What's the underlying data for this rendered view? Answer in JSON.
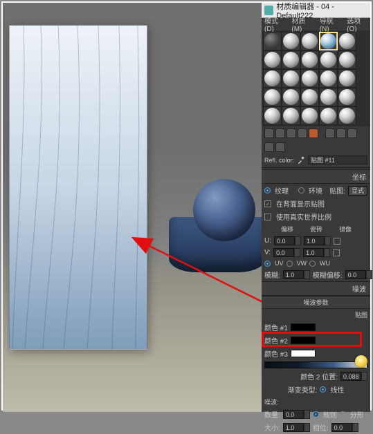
{
  "window": {
    "title": "材质编辑器 - 04 - Default222"
  },
  "menu": {
    "mode": "模式(D)",
    "material": "材质(M)",
    "navigate": "导航(N)",
    "options": "选项(O)"
  },
  "refl": {
    "label": "Refl. color:",
    "swatch": "#c8c8c8",
    "map": "贴图 #11"
  },
  "coord": {
    "header": "坐标",
    "tex": "纹理",
    "env": "环境",
    "maplabel": "贴图:",
    "maptype": "显式",
    "showBehind": "在背面显示贴图",
    "realWorld": "使用真实世界比例",
    "offset": "偏移",
    "tile": "瓷砖",
    "mirror": "镜像",
    "u": "U:",
    "v": "V:",
    "uval": "0.0",
    "vval": "0.0",
    "utile": "1.0",
    "vtile": "1.0",
    "uv": "UV",
    "vw": "VW",
    "wu": "WU",
    "blur": "模糊:",
    "blurval": "1.0",
    "bluroff": "模糊偏移:",
    "bluroffval": "0.0"
  },
  "noise": {
    "header": "噪波",
    "params": "噪波参数",
    "maps": "贴图",
    "c1": "颜色 #1",
    "c2": "颜色 #2",
    "c3": "颜色 #3",
    "pos2": "颜色 2 位置:",
    "pos2val": "0.088",
    "grType": "渐变类型:",
    "linear": "线性",
    "noiseSub": "噪波:",
    "amount": "数量:",
    "amountval": "0.0",
    "regular": "规则",
    "fractal": "分形",
    "size": "大小:",
    "sizeval": "1.0",
    "phase": "相位:",
    "phaseval": "0.0"
  }
}
